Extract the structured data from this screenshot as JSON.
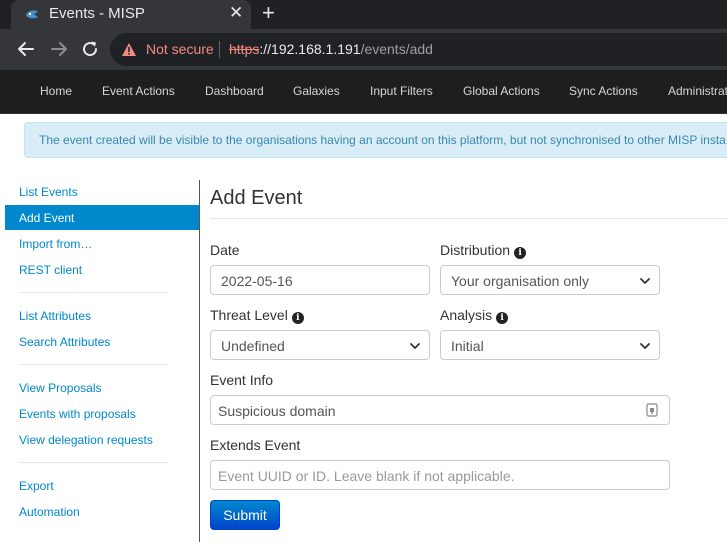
{
  "browser": {
    "tab_title": "Events - MISP",
    "tab_close": "✕",
    "new_tab": "+",
    "security_label": "Not secure",
    "url_scheme": "https",
    "url_sep": "://",
    "url_host": "192.168.1.191",
    "url_path": "/events/add"
  },
  "topnav": {
    "items": [
      "Home",
      "Event Actions",
      "Dashboard",
      "Galaxies",
      "Input Filters",
      "Global Actions",
      "Sync Actions",
      "Administrati"
    ]
  },
  "alert": {
    "text": "The event created will be visible to the organisations having an account on this platform, but not synchronised to other MISP insta"
  },
  "sidebar": {
    "items": [
      "List Events",
      "Add Event",
      "Import from…",
      "REST client",
      "List Attributes",
      "Search Attributes",
      "View Proposals",
      "Events with proposals",
      "View delegation requests",
      "Export",
      "Automation"
    ],
    "active": "Add Event"
  },
  "form": {
    "title": "Add Event",
    "date_label": "Date",
    "date_value": "2022-05-16",
    "distribution_label": "Distribution",
    "distribution_value": "Your organisation only",
    "threat_label": "Threat Level",
    "threat_value": "Undefined",
    "analysis_label": "Analysis",
    "analysis_value": "Initial",
    "info_label": "Event Info",
    "info_value": "Suspicious domain",
    "extends_label": "Extends Event",
    "extends_placeholder": "Event UUID or ID. Leave blank if not applicable.",
    "submit_label": "Submit"
  },
  "colors": {
    "link": "#0088cc",
    "submit": "#0044cc",
    "alert_bg": "#d9edf7",
    "nav_bg": "#1e1e1e"
  }
}
